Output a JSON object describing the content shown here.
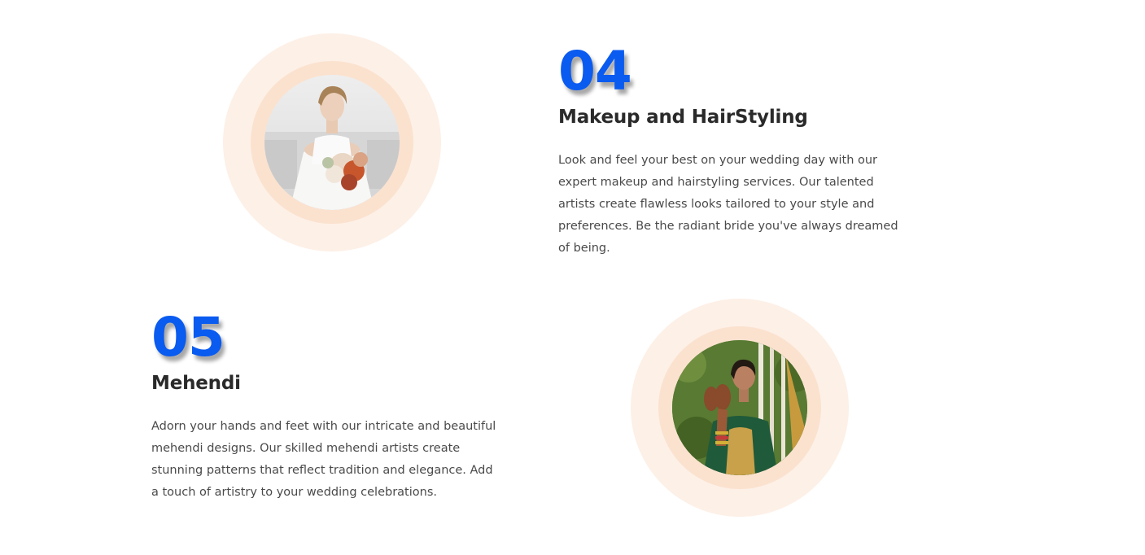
{
  "services": [
    {
      "number": "04",
      "title": "Makeup and HairStyling",
      "description": "Look and feel your best on your wedding day with our expert makeup and hairstyling services. Our talented artists create flawless looks tailored to your style and preferences. Be the radiant bride you've always dreamed of being.",
      "image": "bride-with-bouquet-photo"
    },
    {
      "number": "05",
      "title": "Mehendi",
      "description": "Adorn your hands and feet with our intricate and beautiful mehendi designs. Our skilled mehendi artists create stunning patterns that reflect tradition and elegance. Add a touch of artistry to your wedding celebrations.",
      "image": "bride-showing-mehendi-photo"
    }
  ],
  "colors": {
    "number_blue": "#0a5bf0",
    "circle_outer": "#fdf0e7",
    "circle_mid": "#fbe2cf",
    "heading": "#2a2a2a",
    "body_text": "#4a4a4a"
  }
}
